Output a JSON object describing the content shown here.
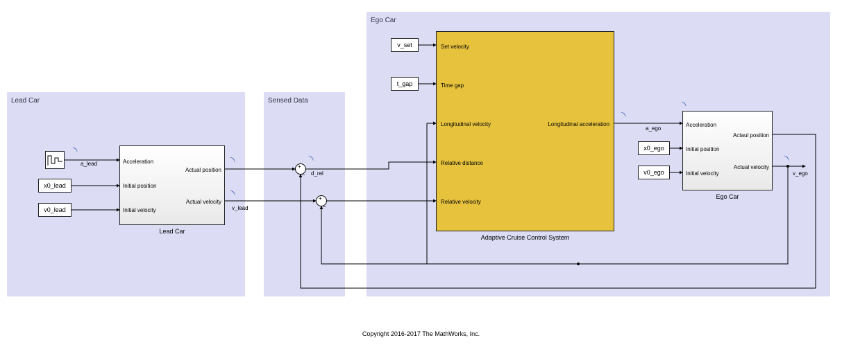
{
  "areas": {
    "lead_car": {
      "title": "Lead Car"
    },
    "sensed_data": {
      "title": "Sensed Data"
    },
    "ego_car": {
      "title": "Ego Car"
    }
  },
  "lead_block": {
    "title": "Lead Car",
    "in": {
      "accel": "Acceleration",
      "x0": "Initial position",
      "v0": "Initial velocity"
    },
    "out": {
      "pos": "Actual position",
      "vel": "Actual velocity"
    }
  },
  "ego_block": {
    "title": "Ego Car",
    "in": {
      "accel": "Acceleration",
      "x0": "Initial position",
      "v0": "Initial velocity"
    },
    "out": {
      "pos": "Actaul position",
      "vel": "Actual velocity"
    }
  },
  "acc_block": {
    "title": "Adaptive Cruise Control System",
    "in": {
      "vset": "Set velocity",
      "tgap": "Time gap",
      "vlon": "Longitudinal velocity",
      "drel": "Relative distance",
      "vrel": "Relative velocity"
    },
    "out": {
      "alon": "Longitudinal acceleration"
    }
  },
  "constants": {
    "vset": "v_set",
    "tgap": "t_gap",
    "x0_lead": "x0_lead",
    "v0_lead": "v0_lead",
    "x0_ego": "x0_ego",
    "v0_ego": "v0_ego"
  },
  "signals": {
    "a_lead": "a_lead",
    "v_lead": "v_lead",
    "d_rel": "d_rel",
    "a_ego": "a_ego",
    "v_ego": "v_ego"
  },
  "copyright": "Copyright 2016-2017 The MathWorks, Inc."
}
